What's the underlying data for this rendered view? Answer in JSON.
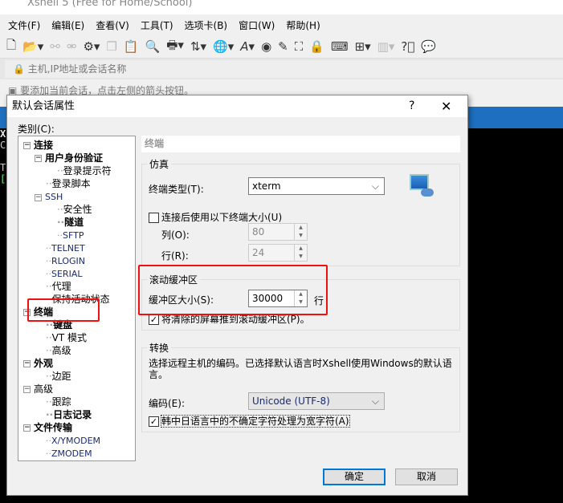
{
  "app": {
    "title": "Xshell 5 (Free for Home/School)",
    "menu": [
      "文件(F)",
      "编辑(E)",
      "查看(V)",
      "工具(T)",
      "选项卡(B)",
      "窗口(W)",
      "帮助(H)"
    ],
    "address_placeholder": "主机,IP地址或会话名称",
    "info_text": "要添加当前会话，点击左侧的箭头按钮。",
    "terminal_lines": [
      "Xs",
      "Co",
      "",
      "Ty",
      "[c"
    ]
  },
  "dialog": {
    "title": "默认会话属性",
    "help": "?",
    "close": "✕",
    "category_label": "类别(C):",
    "tree": [
      {
        "label": "连接",
        "bold": true
      },
      {
        "label": "用户身份验证",
        "bold": true
      },
      {
        "label": "登录提示符"
      },
      {
        "label": "登录脚本"
      },
      {
        "label": "SSH"
      },
      {
        "label": "安全性"
      },
      {
        "label": "隧道",
        "bold": true
      },
      {
        "label": "SFTP"
      },
      {
        "label": "TELNET"
      },
      {
        "label": "RLOGIN"
      },
      {
        "label": "SERIAL"
      },
      {
        "label": "代理"
      },
      {
        "label": "保持活动状态"
      },
      {
        "label": "终端",
        "bold": true,
        "selected": true
      },
      {
        "label": "键盘",
        "bold": true
      },
      {
        "label": "VT 模式"
      },
      {
        "label": "高级"
      },
      {
        "label": "外观",
        "bold": true
      },
      {
        "label": "边距"
      },
      {
        "label": "高级"
      },
      {
        "label": "跟踪"
      },
      {
        "label": "日志记录",
        "bold": true
      },
      {
        "label": "文件传输",
        "bold": true
      },
      {
        "label": "X/YMODEM"
      },
      {
        "label": "ZMODEM"
      }
    ],
    "panel": {
      "header": "终端",
      "emulation": {
        "title": "仿真",
        "terminal_type_label": "终端类型(T):",
        "terminal_type": "xterm",
        "use_size_label": "连接后使用以下终端大小(U)",
        "use_size_checked": false,
        "cols_label": "列(O):",
        "cols": "80",
        "rows_label": "行(R):",
        "rows": "24"
      },
      "scrollback": {
        "title": "滚动缓冲区",
        "size_label": "缓冲区大小(S):",
        "size": "30000",
        "unit": "行",
        "push_label": "将清除的屏幕推到滚动缓冲区(P)。",
        "push_checked": true
      },
      "translation": {
        "title": "转换",
        "description": "选择远程主机的编码。已选择默认语言时Xshell使用Windows的默认语言。",
        "encoding_label": "编码(E):",
        "encoding": "Unicode (UTF-8)",
        "cjk_label": "韩中日语言中的不确定字符处理为宽字符(A)",
        "cjk_checked": true
      }
    },
    "ok": "确定",
    "cancel": "取消"
  }
}
